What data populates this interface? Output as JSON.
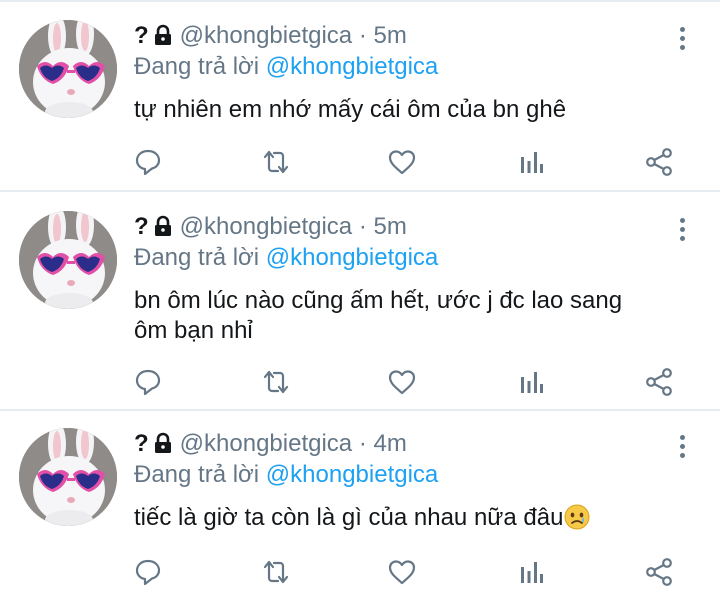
{
  "tweets": [
    {
      "name": "?",
      "handle": "@khongbietgica",
      "separator": "·",
      "time": "5m",
      "reply_prefix": "Đang trả lời",
      "reply_to": "@khongbietgica",
      "text": "tự nhiên em nhớ mấy cái ôm của bn ghê",
      "text_lines": [
        "tự nhiên em nhớ mấy cái ôm của bn ghê"
      ]
    },
    {
      "name": "?",
      "handle": "@khongbietgica",
      "separator": "·",
      "time": "5m",
      "reply_prefix": "Đang trả lời",
      "reply_to": "@khongbietgica",
      "text": "bn ôm lúc nào cũng ấm hết, ước j đc lao sang ôm bạn nhỉ",
      "text_lines": [
        "bn ôm lúc nào cũng ấm hết, ước j đc lao sang",
        "ôm bạn nhỉ"
      ]
    },
    {
      "name": "?",
      "handle": "@khongbietgica",
      "separator": "·",
      "time": "4m",
      "reply_prefix": "Đang trả lời",
      "reply_to": "@khongbietgica",
      "text": "tiếc là giờ ta còn là gì của nhau nữa đâu",
      "text_lines": [
        "tiếc là giờ ta còn là gì của nhau nữa đâu"
      ],
      "emoji": "sad-face-emoji"
    }
  ],
  "icons": {
    "lock": "lock-icon",
    "more": "more-options-icon",
    "reply": "reply-icon",
    "retweet": "retweet-icon",
    "like": "like-icon",
    "analytics": "analytics-icon",
    "share": "share-icon"
  },
  "colors": {
    "text": "#14171a",
    "secondary": "#657786",
    "mention": "#1da1f2",
    "divider": "#e6ecf0"
  }
}
